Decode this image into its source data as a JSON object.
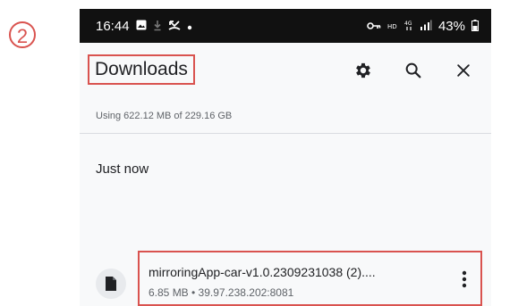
{
  "annotation": {
    "step": "2"
  },
  "status_bar": {
    "time": "16:44",
    "battery": "43%",
    "icons": [
      "image-icon",
      "download-icon",
      "missed-call-icon",
      "dot-icon",
      "key-icon",
      "hd-icon",
      "data-4g-icon",
      "signal-icon",
      "battery-icon"
    ]
  },
  "app_bar": {
    "title": "Downloads",
    "actions": [
      {
        "name": "settings",
        "icon": "gear-icon"
      },
      {
        "name": "search",
        "icon": "search-icon"
      },
      {
        "name": "close",
        "icon": "close-icon"
      }
    ]
  },
  "storage": {
    "usage_text": "Using 622.12 MB of 229.16 GB"
  },
  "section": {
    "label": "Just now"
  },
  "downloads": [
    {
      "name": "mirroringApp-car-v1.0.2309231038 (2)....",
      "meta": "6.85 MB • 39.97.238.202:8081",
      "icon": "file-icon"
    }
  ],
  "colors": {
    "highlight": "#d9534f",
    "status_bar_bg": "#111111",
    "background": "#f8f9fa"
  }
}
